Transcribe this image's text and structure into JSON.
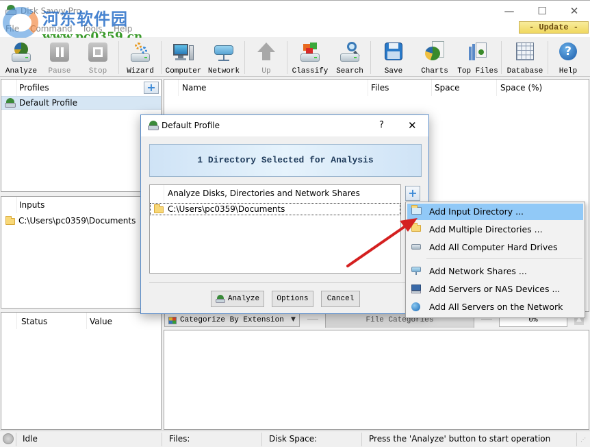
{
  "window": {
    "title": "Disk Savvy Pro",
    "minimize_glyph": "—",
    "maximize_glyph": "☐",
    "close_glyph": "✕"
  },
  "watermark": {
    "chinese_text": "河东软件园",
    "url": "www.pc0359.cn"
  },
  "menubar": {
    "items": [
      {
        "label": "File"
      },
      {
        "label": "Command"
      },
      {
        "label": "Tools"
      },
      {
        "label": "Help"
      }
    ],
    "update_label": "- Update -"
  },
  "toolbar": {
    "buttons": [
      {
        "label": "Analyze",
        "icon": "analyze-disk-icon",
        "enabled": true
      },
      {
        "label": "Pause",
        "icon": "pause-icon",
        "enabled": false
      },
      {
        "label": "Stop",
        "icon": "stop-icon",
        "enabled": false
      },
      {
        "label": "Wizard",
        "icon": "wizard-icon",
        "enabled": true
      },
      {
        "label": "Computer",
        "icon": "computer-icon",
        "enabled": true
      },
      {
        "label": "Network",
        "icon": "network-icon",
        "enabled": true
      },
      {
        "label": "Up",
        "icon": "up-arrow-icon",
        "enabled": false
      },
      {
        "label": "Classify",
        "icon": "classify-icon",
        "enabled": true
      },
      {
        "label": "Search",
        "icon": "search-icon",
        "enabled": true
      },
      {
        "label": "Save",
        "icon": "save-icon",
        "enabled": true
      },
      {
        "label": "Charts",
        "icon": "charts-icon",
        "enabled": true
      },
      {
        "label": "Top Files",
        "icon": "top-files-icon",
        "enabled": true
      },
      {
        "label": "Database",
        "icon": "database-icon",
        "enabled": true
      },
      {
        "label": "Help",
        "icon": "help-icon",
        "enabled": true
      }
    ]
  },
  "profiles_panel": {
    "header": "Profiles",
    "add_glyph": "+",
    "items": [
      {
        "label": "Default Profile",
        "selected": true
      }
    ]
  },
  "inputs_panel": {
    "header": "Inputs",
    "items": [
      {
        "path": "C:\\Users\\pc0359\\Documents"
      }
    ]
  },
  "status_panel": {
    "columns": [
      "Status",
      "Value"
    ]
  },
  "results_panel": {
    "columns": [
      "Name",
      "Files",
      "Space",
      "Space (%)"
    ]
  },
  "categories_bar": {
    "categorize_select": "Categorize By Extension",
    "tab_label": "File Categories",
    "progress_text": "0%",
    "progress": 0
  },
  "statusbar": {
    "state": "Idle",
    "files_label": "Files:",
    "disk_space_label": "Disk Space:",
    "message": "Press the 'Analyze' button to start operation"
  },
  "dialog": {
    "title": "Default Profile",
    "help_glyph": "?",
    "close_glyph": "✕",
    "banner": "1 Directory Selected for Analysis",
    "list_header": "Analyze Disks, Directories and Network Shares",
    "list_items": [
      {
        "path": "C:\\Users\\pc0359\\Documents"
      }
    ],
    "add_glyph": "+",
    "buttons": {
      "analyze": "Analyze",
      "options": "Options",
      "cancel": "Cancel"
    }
  },
  "popup_menu": {
    "items": [
      {
        "label": "Add Input Directory ...",
        "icon": "folder-open-icon",
        "highlighted": true
      },
      {
        "label": "Add Multiple Directories ...",
        "icon": "folder-icon",
        "highlighted": false
      },
      {
        "label": "Add All Computer Hard Drives",
        "icon": "hard-drive-icon",
        "highlighted": false
      },
      {
        "label": "Add Network Shares ...",
        "icon": "network-share-icon",
        "highlighted": false
      },
      {
        "label": "Add Servers or NAS Devices ...",
        "icon": "server-icon",
        "highlighted": false
      },
      {
        "label": "Add All Servers on the Network",
        "icon": "globe-icon",
        "highlighted": false
      }
    ]
  },
  "annotation": {
    "arrow_color": "#d42020"
  }
}
